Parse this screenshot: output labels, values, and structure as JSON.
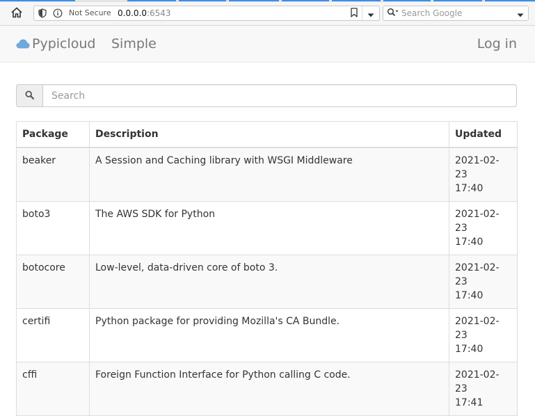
{
  "browser": {
    "security_label": "Not Secure",
    "url_host": "0.0.0.0",
    "url_port": ":6543",
    "search_placeholder": "Search Google",
    "accent_color": "#3b8ee8"
  },
  "navbar": {
    "brand_icon": "cloud-icon",
    "brand_label": "Pypicloud",
    "simple_label": "Simple",
    "login_label": "Log in"
  },
  "search": {
    "icon": "search-icon",
    "placeholder": "Search"
  },
  "table": {
    "headers": {
      "package": "Package",
      "description": "Description",
      "updated": "Updated"
    },
    "rows": [
      {
        "name": "beaker",
        "description": "A Session and Caching library with WSGI Middleware",
        "updated_date": "2021-02-23",
        "updated_time": "17:40"
      },
      {
        "name": "boto3",
        "description": "The AWS SDK for Python",
        "updated_date": "2021-02-23",
        "updated_time": "17:40"
      },
      {
        "name": "botocore",
        "description": "Low-level, data-driven core of boto 3.",
        "updated_date": "2021-02-23",
        "updated_time": "17:40"
      },
      {
        "name": "certifi",
        "description": "Python package for providing Mozilla's CA Bundle.",
        "updated_date": "2021-02-23",
        "updated_time": "17:40"
      },
      {
        "name": "cffi",
        "description": "Foreign Function Interface for Python calling C code.",
        "updated_date": "2021-02-23",
        "updated_time": "17:41"
      }
    ]
  }
}
